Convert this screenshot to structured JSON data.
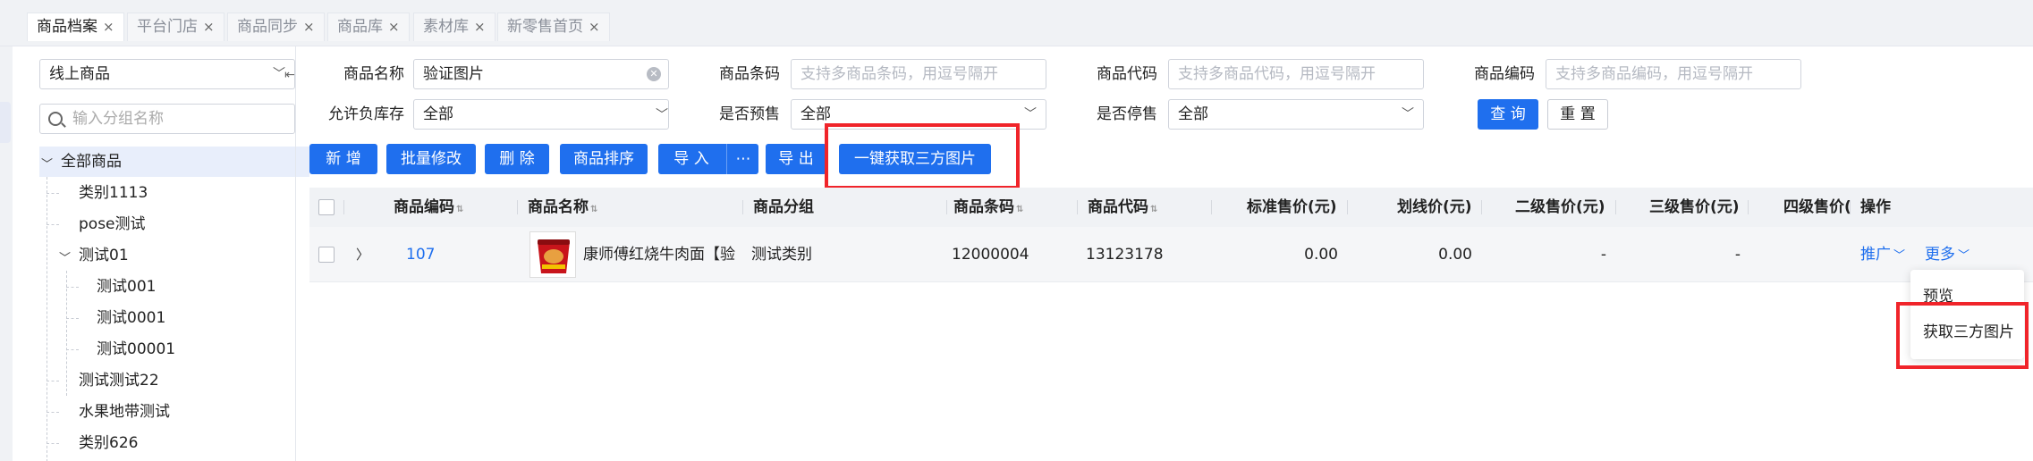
{
  "tabs": [
    {
      "label": "商品档案",
      "active": true
    },
    {
      "label": "平台门店",
      "active": false
    },
    {
      "label": "商品同步",
      "active": false
    },
    {
      "label": "商品库",
      "active": false
    },
    {
      "label": "素材库",
      "active": false
    },
    {
      "label": "新零售首页",
      "active": false
    }
  ],
  "tab_close": "×",
  "sidebar": {
    "channel_select": "线上商品",
    "search_placeholder": "输入分组名称",
    "tree": [
      {
        "label": "全部商品",
        "expanded": true,
        "selected": true
      },
      {
        "label": "类别1113"
      },
      {
        "label": "pose测试"
      },
      {
        "label": "测试01",
        "expanded": true
      },
      {
        "label": "测试001"
      },
      {
        "label": "测试0001"
      },
      {
        "label": "测试00001"
      },
      {
        "label": "测试测试22"
      },
      {
        "label": "水果地带测试"
      },
      {
        "label": "类别626"
      }
    ]
  },
  "filters": {
    "name_label": "商品名称",
    "name_value": "验证图片",
    "barcode_label": "商品条码",
    "barcode_placeholder": "支持多商品条码，用逗号隔开",
    "code_label": "商品代码",
    "code_placeholder": "支持多商品代码，用逗号隔开",
    "number_label": "商品编码",
    "number_placeholder": "支持多商品编码，用逗号隔开",
    "negative_stock_label": "允许负库存",
    "negative_stock_value": "全部",
    "presale_label": "是否预售",
    "presale_value": "全部",
    "discontinued_label": "是否停售",
    "discontinued_value": "全部",
    "query_button": "查 询",
    "reset_button": "重 置"
  },
  "toolbar": {
    "add": "新 增",
    "batch_edit": "批量修改",
    "delete": "删 除",
    "sort": "商品排序",
    "import": "导 入",
    "import_more": "⋯",
    "export": "导 出",
    "fetch_images": "一键获取三方图片"
  },
  "table": {
    "headers": [
      "商品编码",
      "商品名称",
      "商品分组",
      "商品条码",
      "商品代码",
      "标准售价(元)",
      "划线价(元)",
      "二级售价(元)",
      "三级售价(元)",
      "四级售价(",
      "操作"
    ],
    "rows": [
      {
        "code": "107",
        "name": "康师傅红烧牛肉面【验",
        "group": "测试类别",
        "barcode": "12000004",
        "product_code": "13123178",
        "standard_price": "0.00",
        "strike_price": "0.00",
        "level2_price": "-",
        "level3_price": "-",
        "promote": "推广",
        "more": "更多"
      }
    ]
  },
  "more_menu": [
    "预览",
    "获取三方图片"
  ],
  "colors": {
    "primary": "#1f6fee",
    "highlight": "#f0242a"
  }
}
